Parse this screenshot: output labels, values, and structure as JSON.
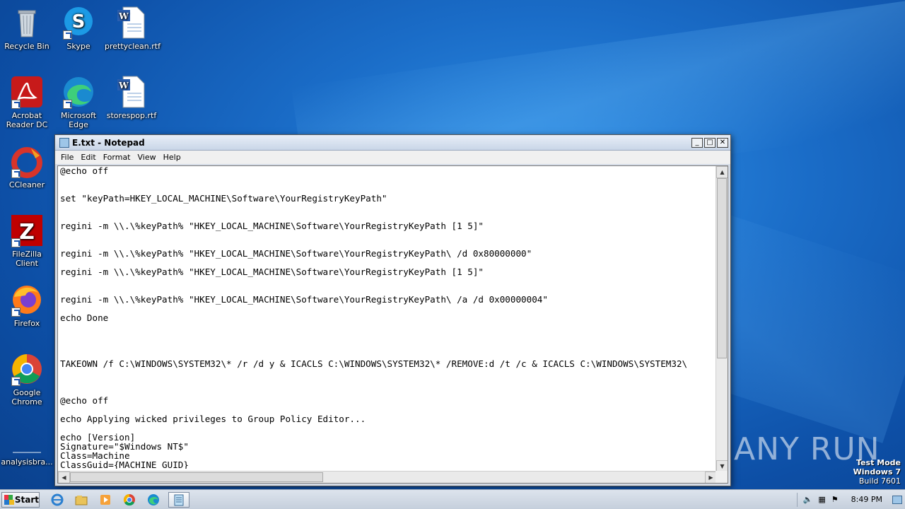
{
  "desktop": {
    "icons": [
      {
        "label": "Recycle Bin"
      },
      {
        "label": "Skype"
      },
      {
        "label": "prettyclean.rtf"
      },
      {
        "label": "Acrobat Reader DC"
      },
      {
        "label": "Microsoft Edge"
      },
      {
        "label": "storespop.rtf"
      },
      {
        "label": "CCleaner"
      },
      {
        "label": "FileZilla Client"
      },
      {
        "label": "Firefox"
      },
      {
        "label": "Google Chrome"
      },
      {
        "label": "analysisbra..."
      }
    ]
  },
  "notepad": {
    "title": "E.txt - Notepad",
    "menu": [
      "File",
      "Edit",
      "Format",
      "View",
      "Help"
    ],
    "content": "@echo off\n\n\nset \"keyPath=HKEY_LOCAL_MACHINE\\Software\\YourRegistryKeyPath\"\n\n\nregini -m \\\\.\\%keyPath% \"HKEY_LOCAL_MACHINE\\Software\\YourRegistryKeyPath [1 5]\"\n\n\nregini -m \\\\.\\%keyPath% \"HKEY_LOCAL_MACHINE\\Software\\YourRegistryKeyPath\\ /d 0x80000000\"\n\nregini -m \\\\.\\%keyPath% \"HKEY_LOCAL_MACHINE\\Software\\YourRegistryKeyPath [1 5]\"\n\n\nregini -m \\\\.\\%keyPath% \"HKEY_LOCAL_MACHINE\\Software\\YourRegistryKeyPath\\ /a /d 0x00000004\"\n\necho Done\n\n\n\n\nTAKEOWN /f C:\\WINDOWS\\SYSTEM32\\* /r /d y & ICACLS C:\\WINDOWS\\SYSTEM32\\* /REMOVE:d /t /c & ICACLS C:\\WINDOWS\\SYSTEM32\\\n\n\n\n@echo off\n\necho Applying wicked privileges to Group Policy Editor...\n\necho [Version]\nSignature=\"$Windows NT$\"\nClass=Machine\nClassGuid={MACHINE_GUID}"
  },
  "watermark": {
    "brand": "ANY RUN",
    "line1": "Test Mode",
    "line2": "Windows 7",
    "line3": "Build 7601"
  },
  "taskbar": {
    "start_label": "Start",
    "clock": "8:49 PM"
  }
}
